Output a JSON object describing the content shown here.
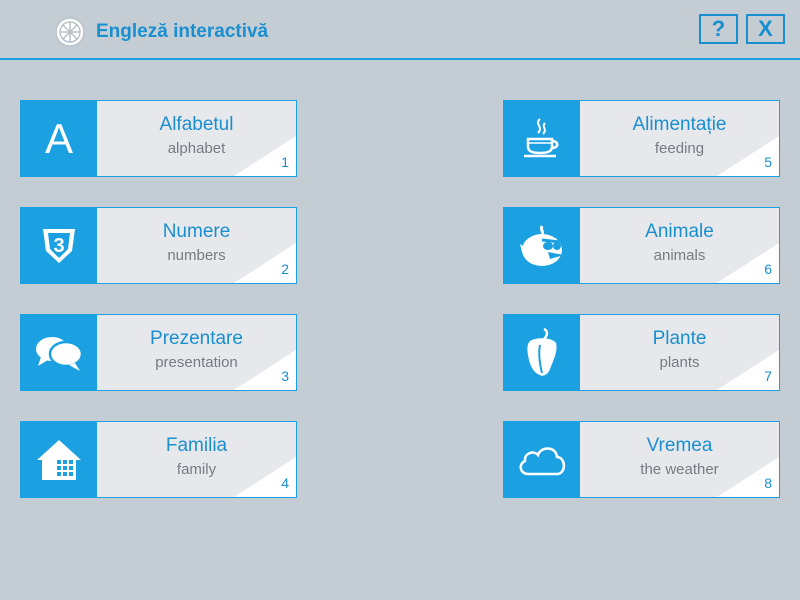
{
  "header": {
    "title": "Engleză interactivă",
    "logo_icon": "wheel-icon",
    "help_label": "?",
    "close_label": "X"
  },
  "colors": {
    "accent": "#1ba1e2",
    "background": "#c5cdd4",
    "tile": "#e6e8ec",
    "title_text": "#1a8fd0",
    "subtitle_text": "#777b80"
  },
  "lessons": [
    {
      "title": "Alfabetul",
      "subtitle": "alphabet",
      "number": "1",
      "icon": "letter-a-icon",
      "icon_text": "A"
    },
    {
      "title": "Numere",
      "subtitle": "numbers",
      "number": "2",
      "icon": "number-3-badge-icon"
    },
    {
      "title": "Prezentare",
      "subtitle": "presentation",
      "number": "3",
      "icon": "chat-bubbles-icon"
    },
    {
      "title": "Familia",
      "subtitle": "family",
      "number": "4",
      "icon": "house-icon"
    },
    {
      "title": "Alimentație",
      "subtitle": "feeding",
      "number": "5",
      "icon": "coffee-cup-icon"
    },
    {
      "title": "Animale",
      "subtitle": "animals",
      "number": "6",
      "icon": "angry-bird-icon"
    },
    {
      "title": "Plante",
      "subtitle": "plants",
      "number": "7",
      "icon": "bell-pepper-icon"
    },
    {
      "title": "Vremea",
      "subtitle": "the weather",
      "number": "8",
      "icon": "cloud-icon"
    }
  ]
}
